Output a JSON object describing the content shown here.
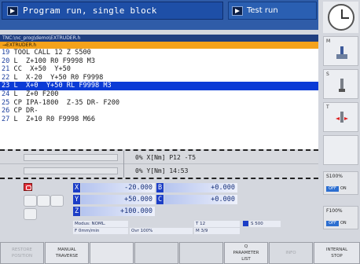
{
  "header": {
    "main_mode": "Program run, single block",
    "secondary_mode": "Test run"
  },
  "program": {
    "path": "TNC:\\nc_prog\\demo\\EXTRUDER.h",
    "file": "→EXTRUDER.h",
    "lines": [
      {
        "num": "19",
        "text": " TOOL CALL 12 Z S500"
      },
      {
        "num": "20",
        "text": " L  Z+100 R0 F9998 M3"
      },
      {
        "num": "21",
        "text": " CC  X+50  Y+50"
      },
      {
        "num": "22",
        "text": " L  X-20  Y+50 R0 F9998"
      },
      {
        "num": "23",
        "text": " L  X+0  Y+50 RL F9998 M3"
      },
      {
        "num": "24",
        "text": " L  Z+0 F200"
      },
      {
        "num": "25",
        "text": " CP IPA-1800  Z-35 DR- F200"
      },
      {
        "num": "26",
        "text": " CP DR-"
      },
      {
        "num": "27",
        "text": " L  Z+10 R0 F9998 M66"
      }
    ],
    "selected_index": 4
  },
  "status": {
    "row1": "0% X[Nm] P12 -T5",
    "row2": "0% Y[Nm] 14:53"
  },
  "positions": {
    "x": {
      "label": "X",
      "value": "-20.000"
    },
    "y": {
      "label": "Y",
      "value": "+50.000"
    },
    "z": {
      "label": "Z",
      "value": "+100.000"
    },
    "b": {
      "label": "B",
      "value": "+0.000"
    },
    "c": {
      "label": "C",
      "value": "+0.000"
    },
    "mode": "Modus: NOML.",
    "feed": "F 0mm/min",
    "ovr": "Ovr 100%",
    "tool": "T 12",
    "spindle": "S 500",
    "mfunc": "M 3/9"
  },
  "side": {
    "btn_m": "M",
    "btn_s": "S",
    "btn_t": "T",
    "spindle_override": "S100%",
    "feed_override": "F100%",
    "off": "OFF",
    "on": "ON"
  },
  "softkeys": {
    "sk1": "RESTORE\nPOSITION",
    "sk2": "MANUAL\nTRAVERSE",
    "sk3": "",
    "sk4": "",
    "sk5": "",
    "sk6": "Q\nPARAMETER\nLIST",
    "sk7": "INFO",
    "sk8": "INTERNAL\nSTOP"
  }
}
